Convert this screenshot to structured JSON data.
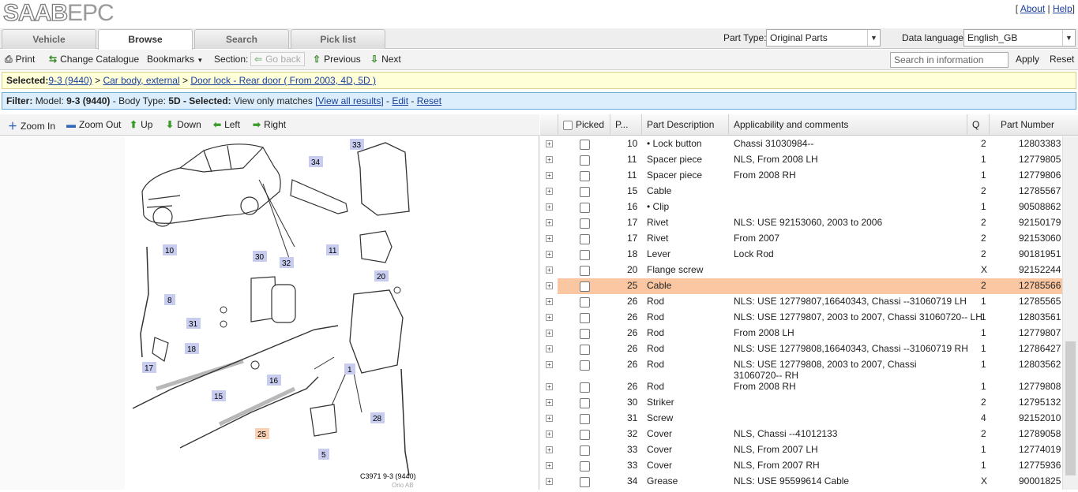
{
  "app": {
    "logo_saab": "SAAB",
    "logo_epc": "EPC",
    "about": "About",
    "help": "Help"
  },
  "tabs": [
    {
      "label": "Vehicle"
    },
    {
      "label": "Browse",
      "active": true
    },
    {
      "label": "Search"
    },
    {
      "label": "Pick list"
    }
  ],
  "part_type": {
    "label": "Part Type:",
    "value": "Original Parts"
  },
  "data_language": {
    "label": "Data language:",
    "value": "English_GB"
  },
  "toolbar": {
    "print": "Print",
    "change_catalogue": "Change Catalogue",
    "bookmarks": "Bookmarks",
    "section": "Section:",
    "go_back": "Go back",
    "previous": "Previous",
    "next": "Next",
    "search_placeholder": "Search in information",
    "apply": "Apply",
    "reset": "Reset"
  },
  "selected": {
    "label": "Selected:",
    "crumb1": "9-3 (9440)",
    "crumb2": "Car body, external",
    "crumb3": "Door lock - Rear door ( From 2003, 4D, 5D )",
    "sep": ">"
  },
  "filter": {
    "label": "Filter:",
    "model_label": "Model:",
    "model": "9-3 (9440)",
    "body_label": "- Body Type:",
    "body": "5D",
    "selected_label": "- Selected:",
    "selected_text": "View only matches",
    "view_all": "[View all results]",
    "dash": "-",
    "edit": "Edit",
    "reset": "Reset"
  },
  "viewer": {
    "zoom_in": "Zoom In",
    "zoom_out": "Zoom Out",
    "up": "Up",
    "down": "Down",
    "left": "Left",
    "right": "Right",
    "caption": "C3971 9-3 (9440)",
    "copyright": "Orio AB",
    "callouts": [
      "33",
      "34",
      "11",
      "10",
      "8",
      "30",
      "32",
      "20",
      "31",
      "18",
      "1",
      "17",
      "16",
      "15",
      "25",
      "5",
      "28"
    ]
  },
  "table": {
    "headers": {
      "picked": "Picked",
      "pos": "P...",
      "desc": "Part Description",
      "appl": "Applicability and comments",
      "qty": "Q",
      "partno": "Part Number"
    },
    "rows": [
      {
        "pos": "10",
        "desc": "• Lock button",
        "appl": "Chassi 31030984--",
        "qty": "2",
        "partno": "12803383"
      },
      {
        "pos": "11",
        "desc": "Spacer piece",
        "appl": "NLS, From 2008 LH",
        "qty": "1",
        "partno": "12779805"
      },
      {
        "pos": "11",
        "desc": "Spacer piece",
        "appl": "From 2008 RH",
        "qty": "1",
        "partno": "12779806"
      },
      {
        "pos": "15",
        "desc": "Cable",
        "appl": "",
        "qty": "2",
        "partno": "12785567"
      },
      {
        "pos": "16",
        "desc": "• Clip",
        "appl": "",
        "qty": "1",
        "partno": "90508862"
      },
      {
        "pos": "17",
        "desc": "Rivet",
        "appl": "NLS: USE 92153060, 2003 to 2006",
        "qty": "2",
        "partno": "92150179"
      },
      {
        "pos": "17",
        "desc": "Rivet",
        "appl": "From 2007",
        "qty": "2",
        "partno": "92153060"
      },
      {
        "pos": "18",
        "desc": "Lever",
        "appl": "Lock Rod",
        "qty": "2",
        "partno": "90181951"
      },
      {
        "pos": "20",
        "desc": "Flange screw",
        "appl": "",
        "qty": "X",
        "partno": "92152244"
      },
      {
        "pos": "25",
        "desc": "Cable",
        "appl": "",
        "qty": "2",
        "partno": "12785566",
        "highlight": true
      },
      {
        "pos": "26",
        "desc": "Rod",
        "appl": "NLS: USE 12779807,16640343, Chassi --31060719 LH",
        "qty": "1",
        "partno": "12785565"
      },
      {
        "pos": "26",
        "desc": "Rod",
        "appl": "NLS: USE 12779807, 2003 to 2007, Chassi 31060720-- LH",
        "qty": "1",
        "partno": "12803561"
      },
      {
        "pos": "26",
        "desc": "Rod",
        "appl": "From 2008 LH",
        "qty": "1",
        "partno": "12779807"
      },
      {
        "pos": "26",
        "desc": "Rod",
        "appl": "NLS: USE 12779808,16640343, Chassi --31060719 RH",
        "qty": "1",
        "partno": "12786427"
      },
      {
        "pos": "26",
        "desc": "Rod",
        "appl": "NLS: USE 12779808, 2003 to 2007, Chassi 31060720-- RH",
        "qty": "1",
        "partno": "12803562",
        "tall": true
      },
      {
        "pos": "26",
        "desc": "Rod",
        "appl": "From 2008 RH",
        "qty": "1",
        "partno": "12779808"
      },
      {
        "pos": "30",
        "desc": "Striker",
        "appl": "",
        "qty": "2",
        "partno": "12795132"
      },
      {
        "pos": "31",
        "desc": "Screw",
        "appl": "",
        "qty": "4",
        "partno": "92152010"
      },
      {
        "pos": "32",
        "desc": "Cover",
        "appl": "NLS, Chassi --41012133",
        "qty": "2",
        "partno": "12789058"
      },
      {
        "pos": "33",
        "desc": "Cover",
        "appl": "NLS, From 2007 LH",
        "qty": "1",
        "partno": "12774019"
      },
      {
        "pos": "33",
        "desc": "Cover",
        "appl": "NLS, From 2007 RH",
        "qty": "1",
        "partno": "12775936"
      },
      {
        "pos": "34",
        "desc": "Grease",
        "appl": "NLS: USE 95599614 Cable",
        "qty": "X",
        "partno": "90001825"
      }
    ]
  }
}
